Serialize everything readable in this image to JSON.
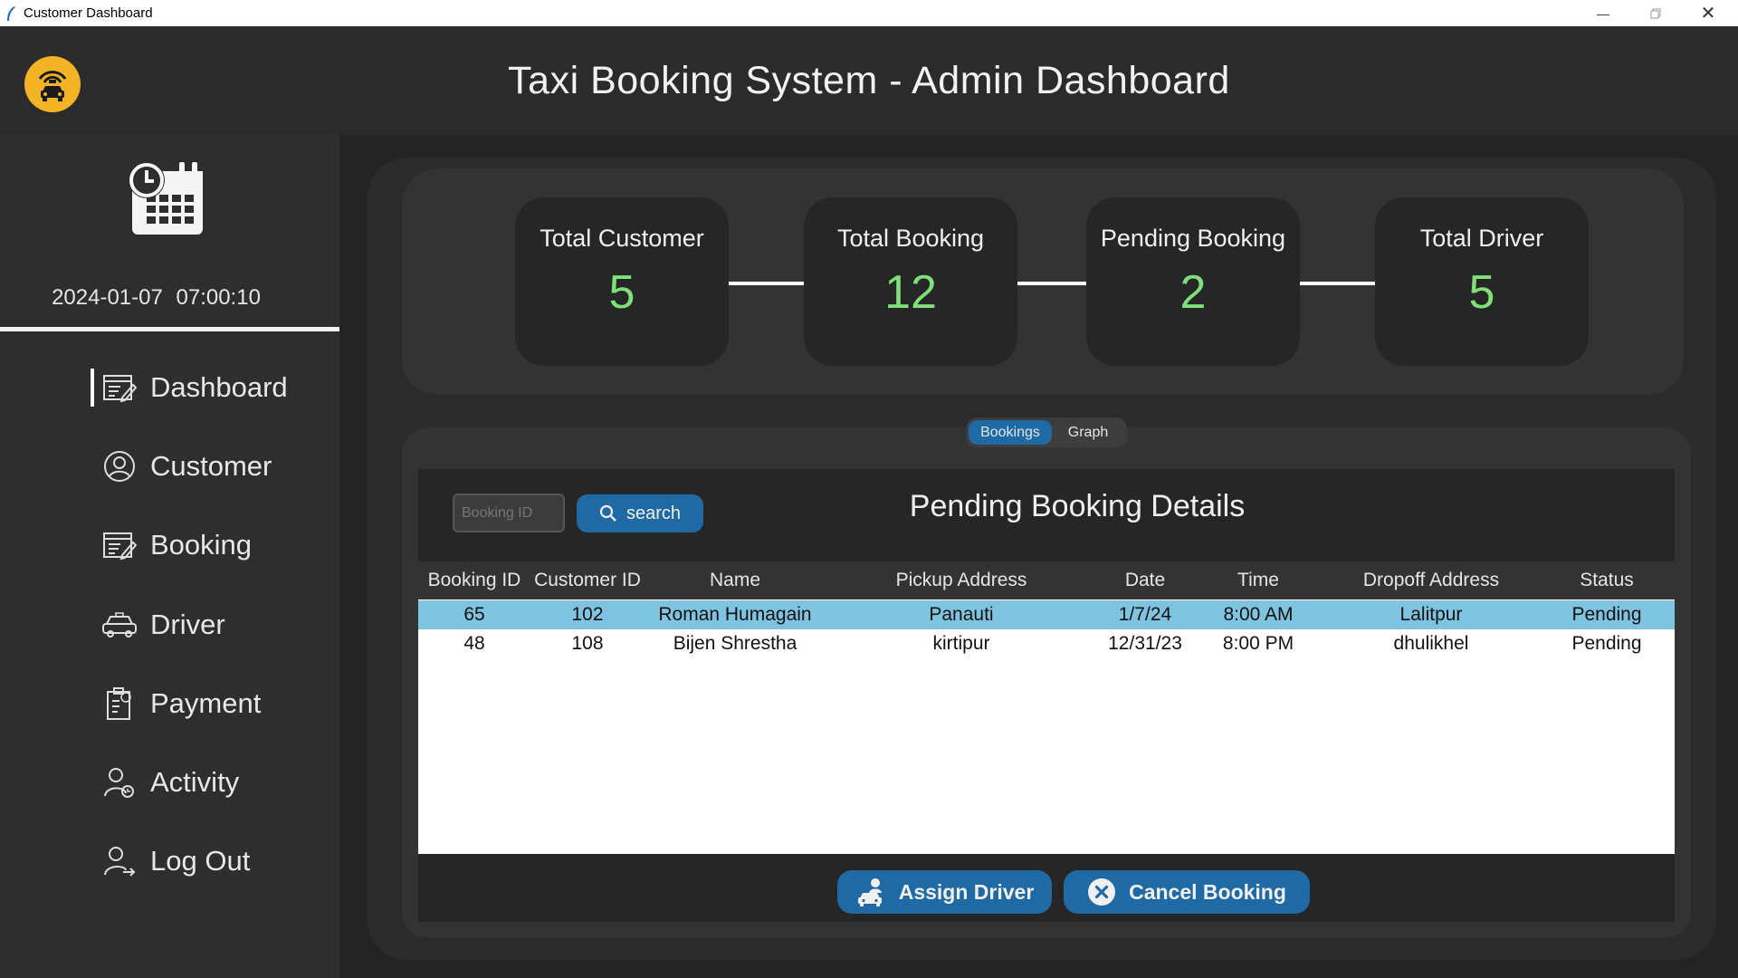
{
  "window": {
    "title": "Customer Dashboard"
  },
  "header": {
    "title": "Taxi Booking System - Admin Dashboard",
    "logo_icon": "taxi-icon",
    "logo_color": "#f4b324"
  },
  "sidebar": {
    "datetime": "2024-01-07  07:00:10",
    "items": [
      {
        "label": "Dashboard",
        "icon": "dashboard-icon",
        "active": true
      },
      {
        "label": "Customer",
        "icon": "customer-icon"
      },
      {
        "label": "Booking",
        "icon": "booking-icon"
      },
      {
        "label": "Driver",
        "icon": "driver-icon"
      },
      {
        "label": "Payment",
        "icon": "payment-icon"
      },
      {
        "label": "Activity",
        "icon": "activity-icon"
      },
      {
        "label": "Log Out",
        "icon": "logout-icon"
      }
    ]
  },
  "stats": [
    {
      "label": "Total Customer",
      "value": "5"
    },
    {
      "label": "Total Booking",
      "value": "12"
    },
    {
      "label": "Pending Booking",
      "value": "2"
    },
    {
      "label": "Total Driver",
      "value": "5"
    }
  ],
  "tabs": {
    "bookings": "Bookings",
    "graph": "Graph",
    "active": "Bookings"
  },
  "search": {
    "placeholder": "Booking ID",
    "button_label": "search"
  },
  "section_title": "Pending Booking Details",
  "table": {
    "columns": [
      "Booking ID",
      "Customer ID",
      "Name",
      "Pickup Address",
      "Date",
      "Time",
      "Dropoff Address",
      "Status"
    ],
    "rows": [
      [
        "65",
        "102",
        "Roman Humagain",
        "Panauti",
        "1/7/24",
        "8:00 AM",
        "Lalitpur",
        "Pending"
      ],
      [
        "48",
        "108",
        "Bijen Shrestha",
        "kirtipur",
        "12/31/23",
        "8:00 PM",
        "dhulikhel",
        "Pending"
      ]
    ],
    "selected_row": 0
  },
  "actions": {
    "assign": "Assign Driver",
    "cancel": "Cancel Booking"
  },
  "colors": {
    "accent": "#1f6aa5",
    "stat_value": "#7fe07a",
    "selected_row": "#7ec4e0"
  }
}
